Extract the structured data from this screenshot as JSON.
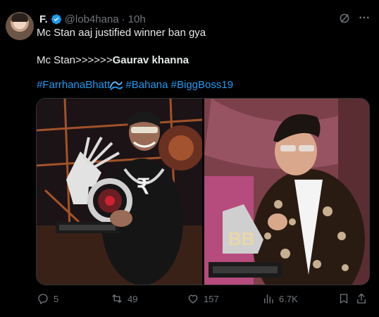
{
  "author": {
    "display_name": "F.",
    "handle": "@lob4hana",
    "separator": "·",
    "time": "10h"
  },
  "tweet": {
    "line1": "Mc Stan aaj justified winner ban gya",
    "line2_prefix": "Mc Stan>>>>>>",
    "line2_bold": "Gaurav khanna",
    "hashtags": [
      "#FarrhanaBhatt",
      "#Bahana",
      "#BiggBoss19"
    ]
  },
  "actions": {
    "replies": "5",
    "reposts": "49",
    "likes": "157",
    "views": "6.7K"
  },
  "colors": {
    "accent": "#1d9bf0",
    "muted": "#71767b",
    "text": "#e7e9ea",
    "background": "#000000"
  },
  "icons": [
    "verified-icon",
    "grok-icon",
    "more-icon",
    "reply-icon",
    "repost-icon",
    "like-icon",
    "views-icon",
    "bookmark-icon",
    "share-icon",
    "wave-emoji"
  ]
}
